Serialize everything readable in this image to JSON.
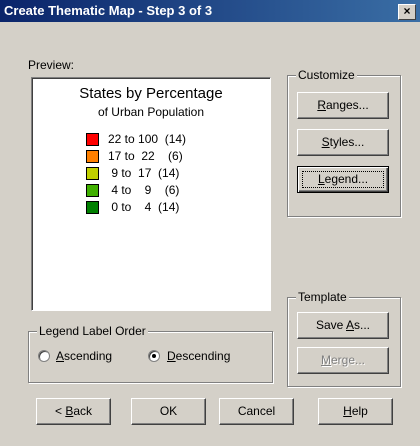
{
  "window": {
    "title": "Create Thematic Map - Step 3 of 3",
    "close_glyph": "×"
  },
  "preview": {
    "label": "Preview:",
    "legend_title": "States by Percentage",
    "legend_subtitle": "of Urban Population",
    "rows": [
      {
        "color": "#ff0000",
        "range": "22 to 100  (14)"
      },
      {
        "color": "#ff8000",
        "range": "17 to  22    (6)"
      },
      {
        "color": "#c0d000",
        "range": " 9 to  17  (14)"
      },
      {
        "color": "#40b000",
        "range": " 4 to    9    (6)"
      },
      {
        "color": "#008000",
        "range": " 0 to    4  (14)"
      }
    ]
  },
  "customize": {
    "title": "Customize",
    "ranges": {
      "pre": "",
      "key": "R",
      "post": "anges..."
    },
    "styles": {
      "pre": "",
      "key": "S",
      "post": "tyles..."
    },
    "legend": {
      "pre": "",
      "key": "L",
      "post": "egend..."
    }
  },
  "template": {
    "title": "Template",
    "save_as": {
      "pre": "Save ",
      "key": "A",
      "post": "s..."
    },
    "merge": {
      "pre": "",
      "key": "M",
      "post": "erge..."
    }
  },
  "legend_order": {
    "title": "Legend Label Order",
    "ascending": {
      "key": "A",
      "post": "scending"
    },
    "descending": {
      "key": "D",
      "post": "escending"
    },
    "selected": "descending"
  },
  "footer": {
    "back": {
      "pre": "< ",
      "key": "B",
      "post": "ack"
    },
    "ok": "OK",
    "cancel": "Cancel",
    "help": {
      "pre": "",
      "key": "H",
      "post": "elp"
    }
  }
}
